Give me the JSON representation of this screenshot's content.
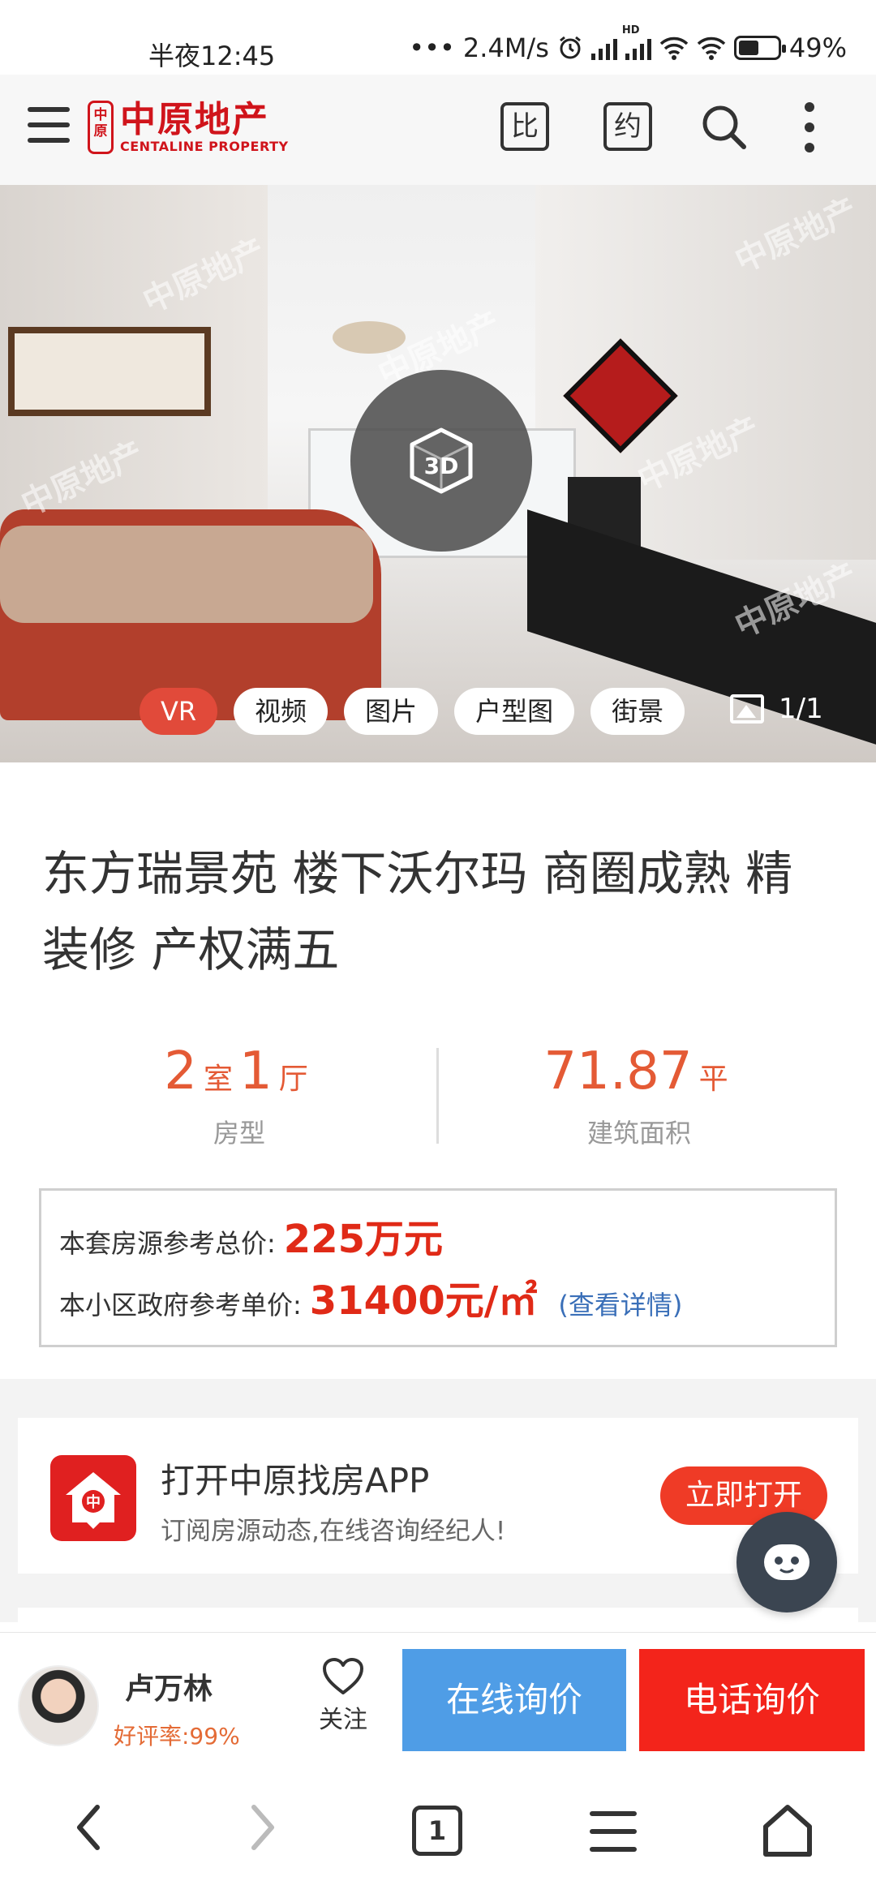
{
  "status_bar": {
    "time": "半夜12:45",
    "network_speed": "2.4M/s",
    "battery": "49%",
    "hd_label": "HD"
  },
  "header": {
    "brand_cn": "中原地产",
    "brand_en": "CENTALINE PROPERTY",
    "logo_mark": "中原",
    "compare_label": "比",
    "appointment_label": "约"
  },
  "gallery": {
    "watermark": "中原地产",
    "tabs": [
      {
        "label": "VR",
        "active": true
      },
      {
        "label": "视频",
        "active": false
      },
      {
        "label": "图片",
        "active": false
      },
      {
        "label": "户型图",
        "active": false
      },
      {
        "label": "街景",
        "active": false
      }
    ],
    "photo_counter": "1/1",
    "vr_badge": "3D"
  },
  "listing": {
    "title": "东方瑞景苑 楼下沃尔玛 商圈成熟 精装修 产权满五",
    "rooms": "2",
    "rooms_unit": "室",
    "halls": "1",
    "halls_unit": "厅",
    "layout_label": "房型",
    "area": "71.87",
    "area_unit": "平",
    "area_label": "建筑面积"
  },
  "price": {
    "total_label": "本套房源参考总价:",
    "total_value": "225万元",
    "unit_label": "本小区政府参考单价:",
    "unit_value": "31400元/㎡",
    "detail_link": "(查看详情)"
  },
  "app_promo": {
    "title": "打开中原找房APP",
    "subtitle": "订阅房源动态,在线咨询经纪人!",
    "button": "立即打开"
  },
  "agent_bar": {
    "name": "卢万林",
    "rating": "好评率:99%",
    "follow": "关注",
    "online_inquiry": "在线询价",
    "phone_inquiry": "电话询价"
  },
  "nav_bar": {
    "tab_count": "1"
  },
  "colors": {
    "accent_red": "#e45a35",
    "price_red": "#e02a17",
    "brand_red": "#d0141b",
    "online_blue": "#4f9de6",
    "call_red": "#f3241b"
  }
}
